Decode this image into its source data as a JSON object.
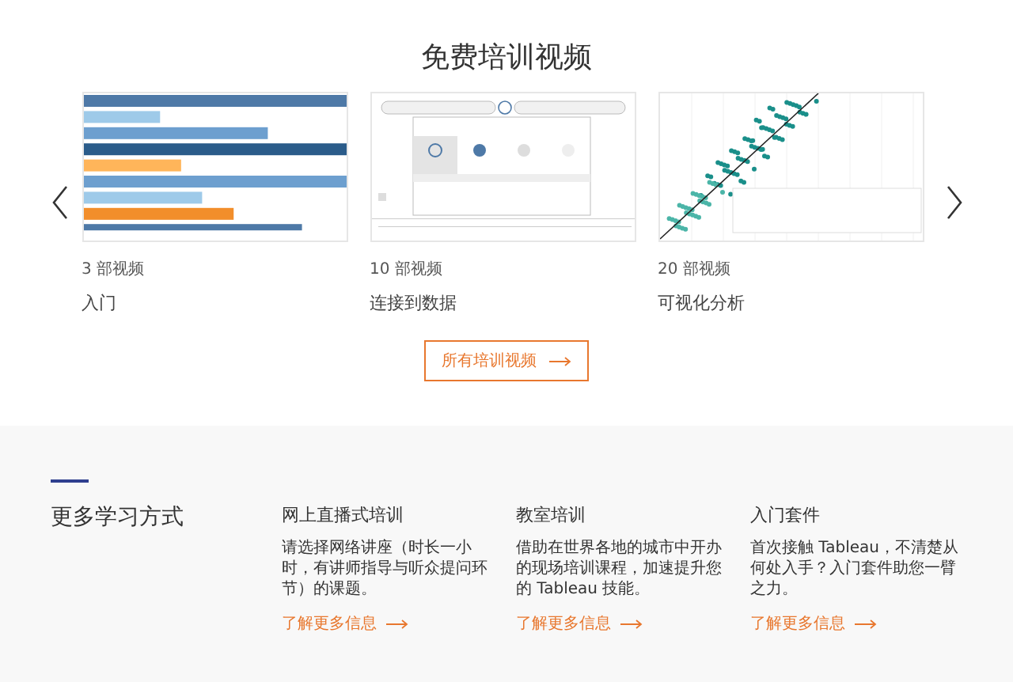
{
  "title": "免费培训视频",
  "videos": [
    {
      "kind": "bars",
      "count": "3 部视频",
      "title": "入门"
    },
    {
      "kind": "join",
      "count": "10 部视频",
      "title": "连接到数据"
    },
    {
      "kind": "scatter",
      "count": "20 部视频",
      "title": "可视化分析"
    }
  ],
  "all_button": {
    "label": "所有培训视频"
  },
  "more": {
    "heading": "更多学习方式",
    "items": [
      {
        "title": "网上直播式培训",
        "text": "请选择网络讲座（时长一小时，有讲师指导与听众提问环节）的课题。",
        "link": "了解更多信息"
      },
      {
        "title": "教室培训",
        "text": "借助在世界各地的城市中开办的现场培训课程，加速提升您的 Tableau 技能。",
        "link": "了解更多信息"
      },
      {
        "title": "入门套件",
        "text": "首次接触 Tableau，不清楚从何处入手？入门套件助您一臂之力。",
        "link": "了解更多信息"
      }
    ]
  }
}
